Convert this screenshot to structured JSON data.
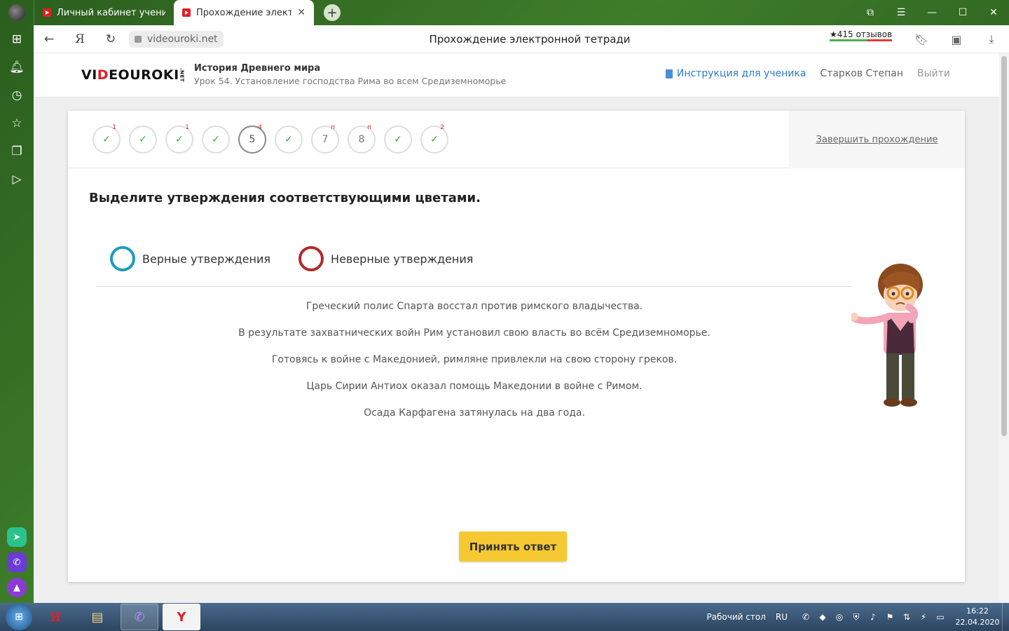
{
  "browser": {
    "tabs": [
      {
        "title": "Личный кабинет ученика",
        "active": false
      },
      {
        "title": "Прохождение электро",
        "active": true
      }
    ],
    "new_tab": "+",
    "url": "videouroki.net",
    "page_title": "Прохождение электронной тетради",
    "reviews": "★415 отзывов"
  },
  "site": {
    "logo_main": "VIDEOUROKI",
    "logo_suffix": ".NET",
    "course_title": "История Древнего мира",
    "lesson": "Урок 54. Установление господства Рима во всем Средиземноморье",
    "instruction_link": "Инструкция для ученика",
    "user_name": "Старков Степан",
    "logout": "Выйти"
  },
  "steps": [
    {
      "label": "✓",
      "mark": "1",
      "status": "done"
    },
    {
      "label": "✓",
      "mark": "",
      "status": "done"
    },
    {
      "label": "✓",
      "mark": "1",
      "status": "done"
    },
    {
      "label": "✓",
      "mark": "",
      "status": "done"
    },
    {
      "label": "5",
      "mark": "4",
      "status": "current"
    },
    {
      "label": "✓",
      "mark": "",
      "status": "done"
    },
    {
      "label": "7",
      "mark": "п",
      "status": "pending"
    },
    {
      "label": "8",
      "mark": "п",
      "status": "pending"
    },
    {
      "label": "✓",
      "mark": "",
      "status": "done"
    },
    {
      "label": "✓",
      "mark": "2",
      "status": "done"
    }
  ],
  "finish_link": "Завершить прохождение",
  "task": {
    "question": "Выделите утверждения соответствующими цветами.",
    "legend": [
      {
        "label": "Верные утверждения",
        "color": "#1e9ac4"
      },
      {
        "label": "Неверные утверждения",
        "color": "#b22a2a"
      }
    ],
    "statements": [
      "Греческий полис Спарта восстал против римского владычества.",
      "В результате захватнических войн Рим установил свою власть во всём Средиземноморье.",
      "Готовясь к войне с Македонией, римляне привлекли на свою сторону греков.",
      "Царь Сирии Антиох оказал помощь Македонии в войне с Римом.",
      "Осада Карфагена затянулась на два года."
    ],
    "accept_button": "Принять ответ"
  },
  "taskbar": {
    "desktop_label": "Рабочий стол",
    "lang": "RU",
    "time": "16:22",
    "date": "22.04.2020",
    "yandex_glyph": "Я",
    "browser_glyph": "Y"
  },
  "colors": {
    "accent": "#f6c932",
    "link": "#2c7ac9",
    "brand_red": "#e31e24",
    "check": "#2eb039"
  }
}
